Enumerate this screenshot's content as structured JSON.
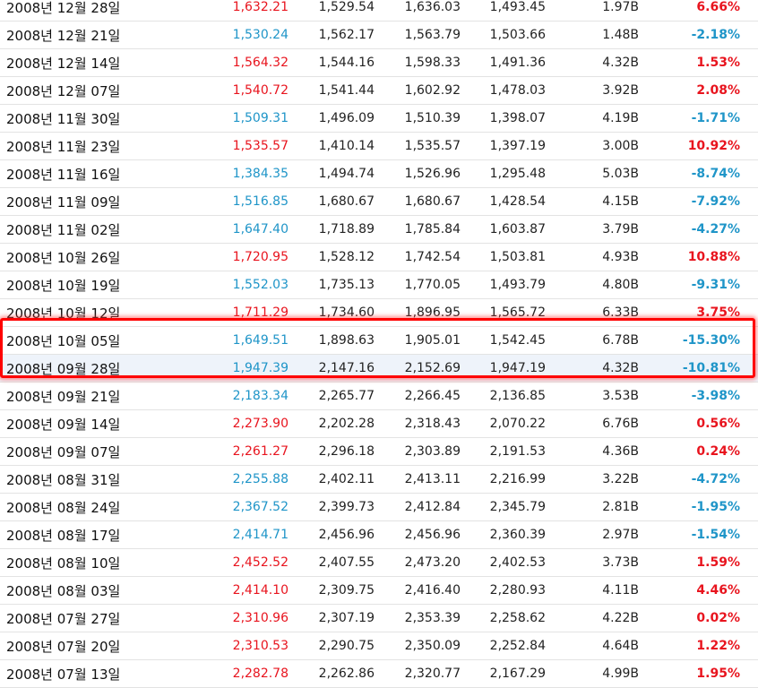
{
  "colors": {
    "up": "#e8141e",
    "down": "#1f95c8",
    "highlight": "#ff0000",
    "row_border": "#e3e3e3"
  },
  "rows": [
    {
      "date": "2008년 12월 28일",
      "close": "1,632.21",
      "open": "1,529.54",
      "high": "1,636.03",
      "low": "1,493.45",
      "volume": "1.97B",
      "change": "6.66%",
      "dir": "up"
    },
    {
      "date": "2008년 12월 21일",
      "close": "1,530.24",
      "open": "1,562.17",
      "high": "1,563.79",
      "low": "1,503.66",
      "volume": "1.48B",
      "change": "-2.18%",
      "dir": "down"
    },
    {
      "date": "2008년 12월 14일",
      "close": "1,564.32",
      "open": "1,544.16",
      "high": "1,598.33",
      "low": "1,491.36",
      "volume": "4.32B",
      "change": "1.53%",
      "dir": "up"
    },
    {
      "date": "2008년 12월 07일",
      "close": "1,540.72",
      "open": "1,541.44",
      "high": "1,602.92",
      "low": "1,478.03",
      "volume": "3.92B",
      "change": "2.08%",
      "dir": "up"
    },
    {
      "date": "2008년 11월 30일",
      "close": "1,509.31",
      "open": "1,496.09",
      "high": "1,510.39",
      "low": "1,398.07",
      "volume": "4.19B",
      "change": "-1.71%",
      "dir": "down"
    },
    {
      "date": "2008년 11월 23일",
      "close": "1,535.57",
      "open": "1,410.14",
      "high": "1,535.57",
      "low": "1,397.19",
      "volume": "3.00B",
      "change": "10.92%",
      "dir": "up"
    },
    {
      "date": "2008년 11월 16일",
      "close": "1,384.35",
      "open": "1,494.74",
      "high": "1,526.96",
      "low": "1,295.48",
      "volume": "5.03B",
      "change": "-8.74%",
      "dir": "down"
    },
    {
      "date": "2008년 11월 09일",
      "close": "1,516.85",
      "open": "1,680.67",
      "high": "1,680.67",
      "low": "1,428.54",
      "volume": "4.15B",
      "change": "-7.92%",
      "dir": "down"
    },
    {
      "date": "2008년 11월 02일",
      "close": "1,647.40",
      "open": "1,718.89",
      "high": "1,785.84",
      "low": "1,603.87",
      "volume": "3.79B",
      "change": "-4.27%",
      "dir": "down"
    },
    {
      "date": "2008년 10월 26일",
      "close": "1,720.95",
      "open": "1,528.12",
      "high": "1,742.54",
      "low": "1,503.81",
      "volume": "4.93B",
      "change": "10.88%",
      "dir": "up"
    },
    {
      "date": "2008년 10월 19일",
      "close": "1,552.03",
      "open": "1,735.13",
      "high": "1,770.05",
      "low": "1,493.79",
      "volume": "4.80B",
      "change": "-9.31%",
      "dir": "down"
    },
    {
      "date": "2008년 10월 12일",
      "close": "1,711.29",
      "open": "1,734.60",
      "high": "1,896.95",
      "low": "1,565.72",
      "volume": "6.33B",
      "change": "3.75%",
      "dir": "up"
    },
    {
      "date": "2008년 10월 05일",
      "close": "1,649.51",
      "open": "1,898.63",
      "high": "1,905.01",
      "low": "1,542.45",
      "volume": "6.78B",
      "change": "-15.30%",
      "dir": "down"
    },
    {
      "date": "2008년 09월 28일",
      "close": "1,947.39",
      "open": "2,147.16",
      "high": "2,152.69",
      "low": "1,947.19",
      "volume": "4.32B",
      "change": "-10.81%",
      "dir": "down",
      "selected": true
    },
    {
      "date": "2008년 09월 21일",
      "close": "2,183.34",
      "open": "2,265.77",
      "high": "2,266.45",
      "low": "2,136.85",
      "volume": "3.53B",
      "change": "-3.98%",
      "dir": "down"
    },
    {
      "date": "2008년 09월 14일",
      "close": "2,273.90",
      "open": "2,202.28",
      "high": "2,318.43",
      "low": "2,070.22",
      "volume": "6.76B",
      "change": "0.56%",
      "dir": "up"
    },
    {
      "date": "2008년 09월 07일",
      "close": "2,261.27",
      "open": "2,296.18",
      "high": "2,303.89",
      "low": "2,191.53",
      "volume": "4.36B",
      "change": "0.24%",
      "dir": "up"
    },
    {
      "date": "2008년 08월 31일",
      "close": "2,255.88",
      "open": "2,402.11",
      "high": "2,413.11",
      "low": "2,216.99",
      "volume": "3.22B",
      "change": "-4.72%",
      "dir": "down"
    },
    {
      "date": "2008년 08월 24일",
      "close": "2,367.52",
      "open": "2,399.73",
      "high": "2,412.84",
      "low": "2,345.79",
      "volume": "2.81B",
      "change": "-1.95%",
      "dir": "down"
    },
    {
      "date": "2008년 08월 17일",
      "close": "2,414.71",
      "open": "2,456.96",
      "high": "2,456.96",
      "low": "2,360.39",
      "volume": "2.97B",
      "change": "-1.54%",
      "dir": "down"
    },
    {
      "date": "2008년 08월 10일",
      "close": "2,452.52",
      "open": "2,407.55",
      "high": "2,473.20",
      "low": "2,402.53",
      "volume": "3.73B",
      "change": "1.59%",
      "dir": "up"
    },
    {
      "date": "2008년 08월 03일",
      "close": "2,414.10",
      "open": "2,309.75",
      "high": "2,416.40",
      "low": "2,280.93",
      "volume": "4.11B",
      "change": "4.46%",
      "dir": "up"
    },
    {
      "date": "2008년 07월 27일",
      "close": "2,310.96",
      "open": "2,307.19",
      "high": "2,353.39",
      "low": "2,258.62",
      "volume": "4.22B",
      "change": "0.02%",
      "dir": "up"
    },
    {
      "date": "2008년 07월 20일",
      "close": "2,310.53",
      "open": "2,290.75",
      "high": "2,350.09",
      "low": "2,252.84",
      "volume": "4.64B",
      "change": "1.22%",
      "dir": "up"
    },
    {
      "date": "2008년 07월 13일",
      "close": "2,282.78",
      "open": "2,262.86",
      "high": "2,320.77",
      "low": "2,167.29",
      "volume": "4.99B",
      "change": "1.95%",
      "dir": "up"
    }
  ]
}
